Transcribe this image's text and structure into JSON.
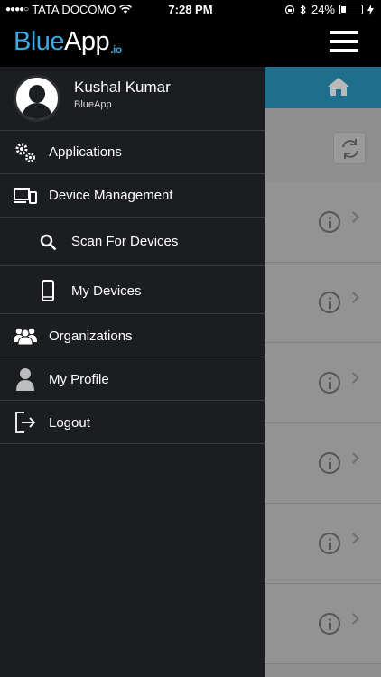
{
  "status_bar": {
    "carrier": "TATA DOCOMO",
    "time": "7:28 PM",
    "battery": "24%",
    "battery_level": 0.24
  },
  "app_header": {
    "logo_part1": "Blue",
    "logo_part2": "App",
    "logo_suffix": ".io"
  },
  "drawer": {
    "user_name": "Kushal Kumar",
    "user_org": "BlueApp",
    "items": [
      {
        "label": "Applications",
        "icon": "gears-icon"
      },
      {
        "label": "Device Management",
        "icon": "devices-icon"
      },
      {
        "label": "Scan For Devices",
        "icon": "search-icon"
      },
      {
        "label": "My Devices",
        "icon": "phone-icon"
      },
      {
        "label": "Organizations",
        "icon": "group-icon"
      },
      {
        "label": "My Profile",
        "icon": "person-icon"
      },
      {
        "label": "Logout",
        "icon": "logout-icon"
      }
    ]
  },
  "colors": {
    "accent": "#3aa9e0",
    "drawer_bg": "#1b1d20",
    "topbar": "#1f6f8c"
  }
}
